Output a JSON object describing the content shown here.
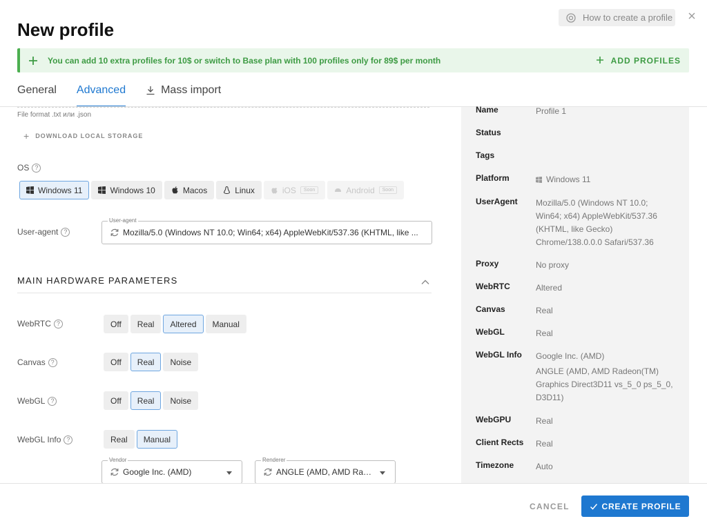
{
  "dialog": {
    "title": "New profile",
    "how_to": "How to create a profile"
  },
  "banner": {
    "text": "You can add 10 extra profiles for 10$ or switch to Base plan with 100 profiles only for 89$ per month",
    "action": "ADD PROFILES",
    "color": "#4caf50"
  },
  "tabs": [
    {
      "label": "General",
      "active": false
    },
    {
      "label": "Advanced",
      "active": true
    },
    {
      "label": "Mass import",
      "active": false,
      "icon": "download-icon"
    }
  ],
  "storage": {
    "file_format": "File format .txt или .json",
    "download_link": "DOWNLOAD LOCAL STORAGE"
  },
  "os": {
    "label": "OS",
    "options": [
      {
        "label": "Windows 11",
        "icon": "windows-icon",
        "selected": true
      },
      {
        "label": "Windows 10",
        "icon": "windows-icon"
      },
      {
        "label": "Macos",
        "icon": "apple-icon"
      },
      {
        "label": "Linux",
        "icon": "linux-icon"
      },
      {
        "label": "iOS",
        "icon": "apple-icon",
        "disabled": true,
        "badge": "Soon"
      },
      {
        "label": "Android",
        "icon": "android-icon",
        "disabled": true,
        "badge": "Soon"
      }
    ]
  },
  "user_agent": {
    "label": "User-agent",
    "field_label": "User-agent",
    "value": "Mozilla/5.0 (Windows NT 10.0; Win64; x64) AppleWebKit/537.36 (KHTML, like ..."
  },
  "hardware": {
    "title": "MAIN HARDWARE PARAMETERS",
    "webrtc": {
      "label": "WebRTC",
      "options": [
        "Off",
        "Real",
        "Altered",
        "Manual"
      ],
      "selected": "Altered"
    },
    "canvas": {
      "label": "Canvas",
      "options": [
        "Off",
        "Real",
        "Noise"
      ],
      "selected": "Real"
    },
    "webgl": {
      "label": "WebGL",
      "options": [
        "Off",
        "Real",
        "Noise"
      ],
      "selected": "Real"
    },
    "webgl_info": {
      "label": "WebGL Info",
      "options": [
        "Real",
        "Manual"
      ],
      "selected": "Manual",
      "vendor_label": "Vendor",
      "vendor_value": "Google Inc. (AMD)",
      "renderer_label": "Renderer",
      "renderer_value": "ANGLE (AMD, AMD Rad..."
    }
  },
  "summary": [
    {
      "key": "Name",
      "value": "Profile 1"
    },
    {
      "key": "Status",
      "value": ""
    },
    {
      "key": "Tags",
      "value": ""
    },
    {
      "key": "Platform",
      "value": "Windows 11",
      "icon": "windows-icon"
    },
    {
      "key": "UserAgent",
      "value": "Mozilla/5.0 (Windows NT 10.0; Win64; x64) AppleWebKit/537.36 (KHTML, like Gecko) Chrome/138.0.0.0 Safari/537.36"
    },
    {
      "key": "Proxy",
      "value": "No proxy"
    },
    {
      "key": "WebRTC",
      "value": "Altered"
    },
    {
      "key": "Canvas",
      "value": "Real"
    },
    {
      "key": "WebGL",
      "value": "Real"
    },
    {
      "key": "WebGL Info",
      "value": "Google Inc. (AMD)",
      "value2": "ANGLE (AMD, AMD Radeon(TM) Graphics Direct3D11 vs_5_0 ps_5_0, D3D11)"
    },
    {
      "key": "WebGPU",
      "value": "Real"
    },
    {
      "key": "Client Rects",
      "value": "Real"
    },
    {
      "key": "Timezone",
      "value": "Auto"
    }
  ],
  "footer": {
    "cancel": "CANCEL",
    "create": "CREATE PROFILE",
    "accent": "#1e78d0"
  }
}
